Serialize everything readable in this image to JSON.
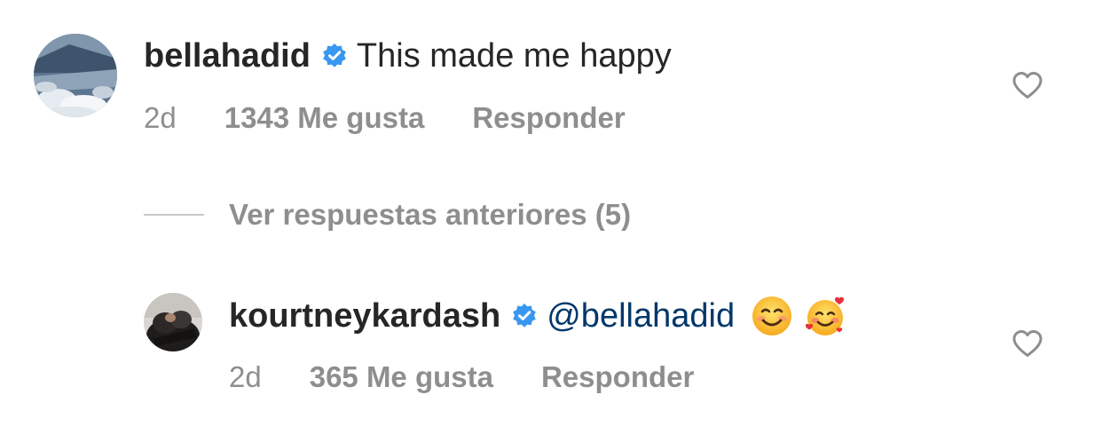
{
  "comments": [
    {
      "username": "bellahadid",
      "verified_icon": "verified-badge-icon",
      "text": "This made me happy",
      "time": "2d",
      "likes": "1343 Me gusta",
      "reply": "Responder",
      "like_icon": "heart-outline-icon"
    }
  ],
  "view_replies": {
    "label": "Ver respuestas anteriores (5)"
  },
  "replies": [
    {
      "username": "kourtneykardash",
      "verified_icon": "verified-badge-icon",
      "mention": "@bellahadid",
      "emojis": [
        "smiling-face-emoji",
        "smiling-face-with-hearts-emoji"
      ],
      "time": "2d",
      "likes": "365 Me gusta",
      "reply": "Responder",
      "like_icon": "heart-outline-icon"
    }
  ],
  "colors": {
    "text": "#262626",
    "secondary": "#8e8e8e",
    "mention": "#00376b",
    "verified": "#3897f0"
  }
}
